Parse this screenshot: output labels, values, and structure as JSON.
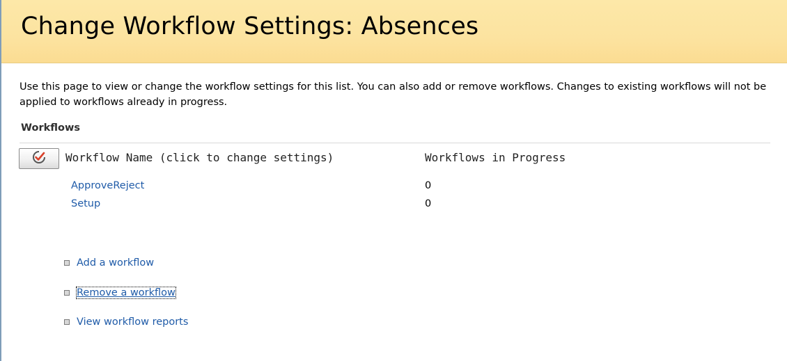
{
  "page": {
    "title": "Change Workflow Settings: Absences",
    "description": "Use this page to view or change the workflow settings for this list. You can also add or remove workflows. Changes to existing workflows will not be applied to workflows already in progress."
  },
  "workflows": {
    "heading": "Workflows",
    "columns": {
      "name": "Workflow Name (click to change settings)",
      "in_progress": "Workflows in Progress"
    },
    "rows": [
      {
        "name": "ApproveReject",
        "in_progress": "0"
      },
      {
        "name": "Setup",
        "in_progress": "0"
      }
    ]
  },
  "actions": [
    {
      "label": "Add a workflow"
    },
    {
      "label": "Remove a workflow"
    },
    {
      "label": "View workflow reports"
    }
  ],
  "icons": {
    "column_button": "workflow-check-icon",
    "action_bullet": "square-bullet-icon"
  },
  "colors": {
    "title_band": "#fce3a0",
    "link": "#1f5ba8",
    "icon_accent": "#d9412a"
  }
}
